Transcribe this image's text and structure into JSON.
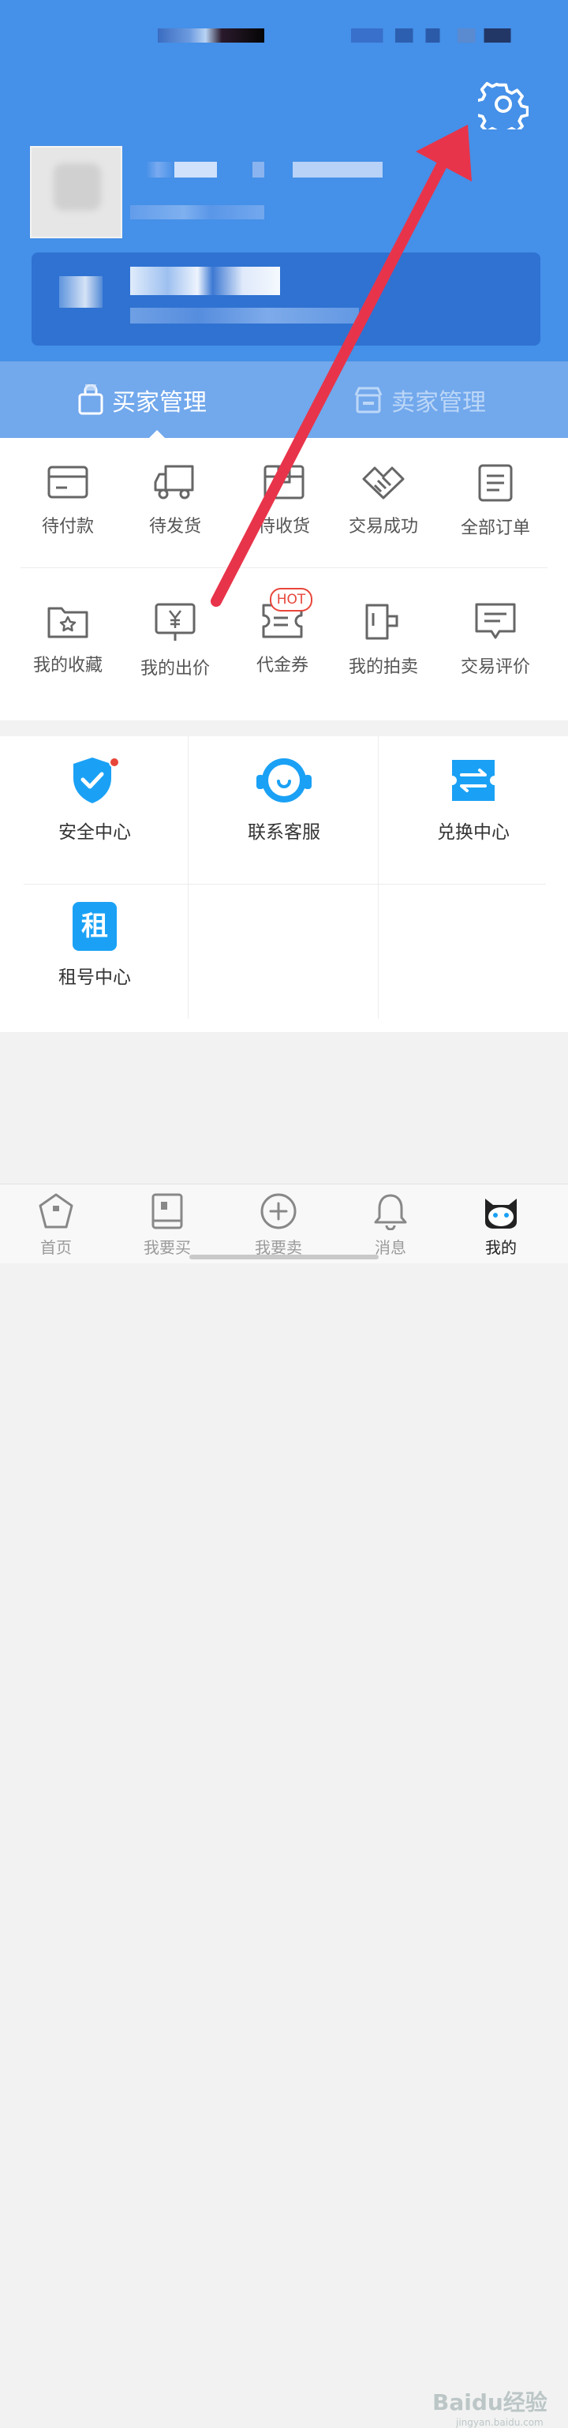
{
  "header": {
    "settings_icon": "gear-icon"
  },
  "tabs": [
    {
      "label": "买家管理",
      "icon": "shopping-bag-icon",
      "active": true
    },
    {
      "label": "卖家管理",
      "icon": "store-icon",
      "active": false
    }
  ],
  "orders": {
    "row1": [
      {
        "label": "待付款",
        "icon": "card-icon"
      },
      {
        "label": "待发货",
        "icon": "truck-icon"
      },
      {
        "label": "待收货",
        "icon": "box-icon"
      },
      {
        "label": "交易成功",
        "icon": "handshake-icon"
      },
      {
        "label": "全部订单",
        "icon": "document-icon"
      }
    ],
    "row2": [
      {
        "label": "我的收藏",
        "icon": "star-folder-icon"
      },
      {
        "label": "我的出价",
        "icon": "yen-board-icon"
      },
      {
        "label": "代金券",
        "icon": "coupon-icon",
        "badge": "HOT"
      },
      {
        "label": "我的拍卖",
        "icon": "auction-icon"
      },
      {
        "label": "交易评价",
        "icon": "comment-icon"
      }
    ]
  },
  "services": [
    {
      "label": "安全中心",
      "icon": "shield-check-icon"
    },
    {
      "label": "联系客服",
      "icon": "headset-icon"
    },
    {
      "label": "兑换中心",
      "icon": "exchange-icon"
    },
    {
      "label": "租号中心",
      "icon": "rent-icon",
      "glyph": "租"
    }
  ],
  "bottom_nav": [
    {
      "label": "首页",
      "icon": "home-icon"
    },
    {
      "label": "我要买",
      "icon": "book-icon"
    },
    {
      "label": "我要卖",
      "icon": "plus-circle-icon"
    },
    {
      "label": "消息",
      "icon": "bell-icon"
    },
    {
      "label": "我的",
      "icon": "cat-avatar-icon",
      "active": true
    }
  ],
  "watermark": {
    "text": "Baidu经验",
    "sub": "jingyan.baidu.com"
  },
  "colors": {
    "header_bg": "#4590e8",
    "accent_blue": "#1aa1f5",
    "badge_red": "#e8463a",
    "annotation_arrow": "#e8344a"
  }
}
